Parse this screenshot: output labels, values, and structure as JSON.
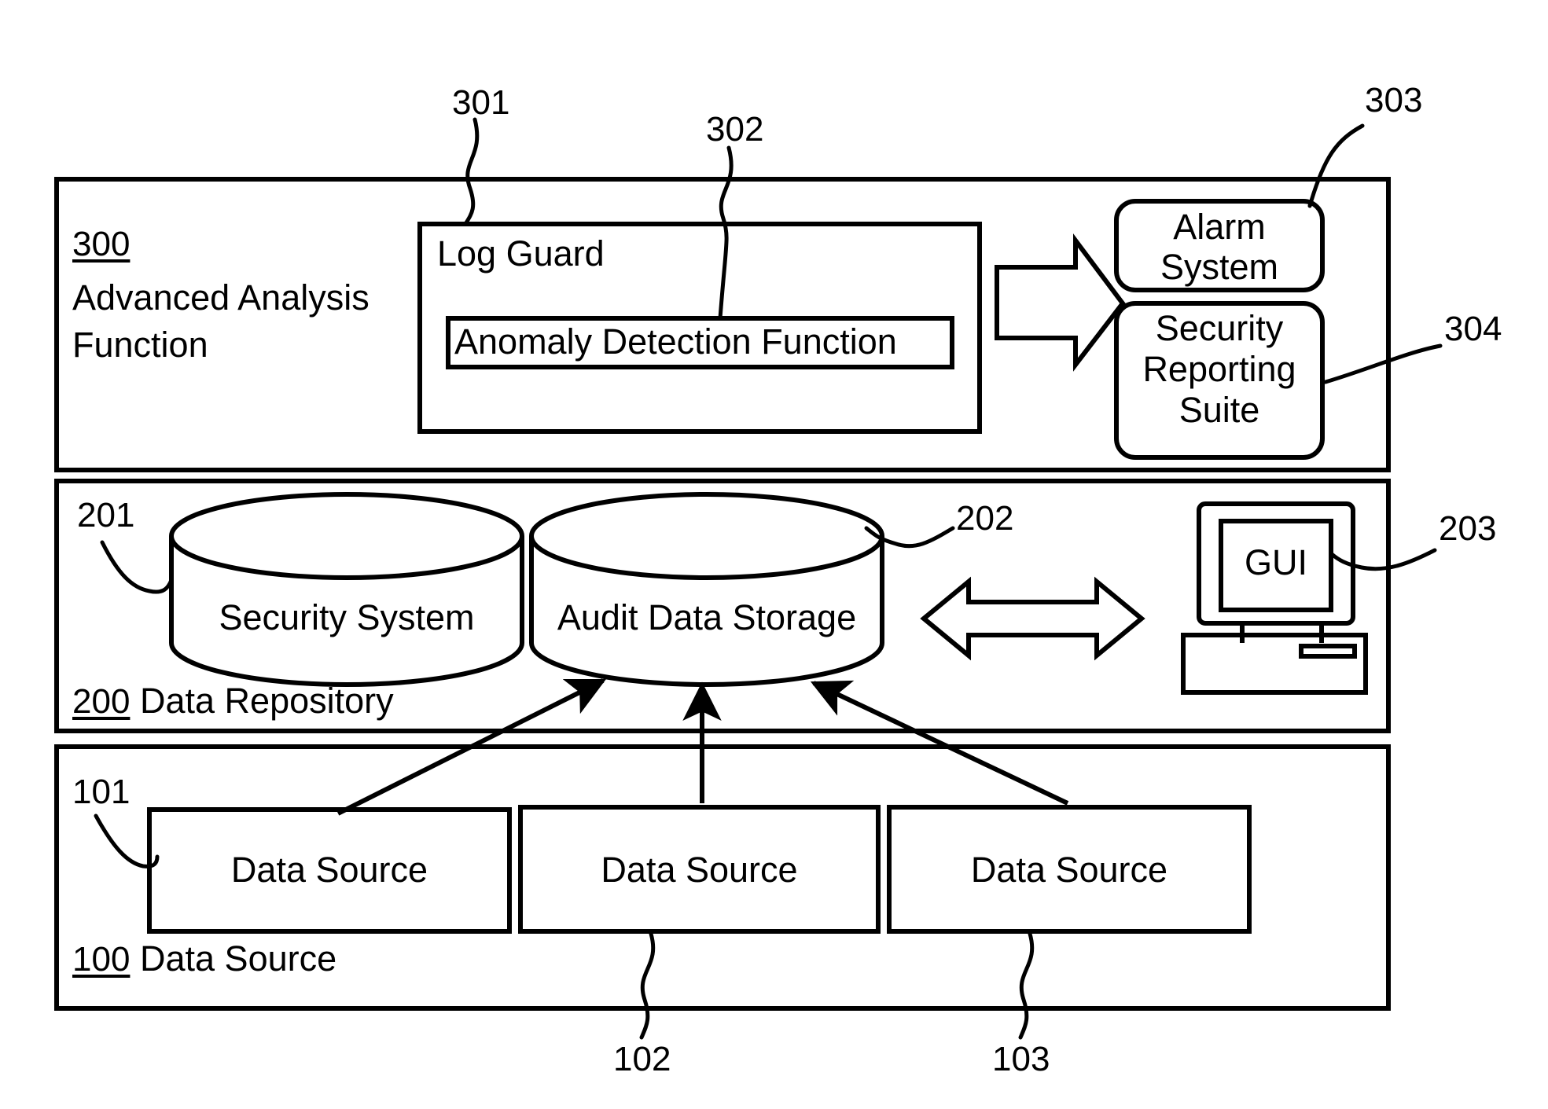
{
  "diagram": {
    "type": "block-diagram",
    "style": "patent-line-art",
    "line_color": "#000000",
    "background": "#ffffff"
  },
  "sections": [
    {
      "ref": "300",
      "title": "Advanced Analysis Function",
      "children": [
        {
          "ref": "301",
          "label": "Log Guard"
        },
        {
          "ref": "302",
          "label": "Anomaly Detection Function"
        },
        {
          "ref": "303",
          "label": "Alarm System"
        },
        {
          "ref": "304",
          "label": "Security Reporting Suite"
        }
      ]
    },
    {
      "ref": "200",
      "title": "Data Repository",
      "children": [
        {
          "ref": "201",
          "label": "Security System"
        },
        {
          "ref": "202",
          "label": "Audit Data Storage"
        },
        {
          "ref": "203",
          "label": "GUI"
        }
      ]
    },
    {
      "ref": "100",
      "title": "Data Source",
      "children": [
        {
          "ref": "101",
          "label": "Data Source"
        },
        {
          "ref": "102",
          "label": "Data Source"
        },
        {
          "ref": "103",
          "label": "Data Source"
        }
      ]
    }
  ],
  "labels": {
    "ref_300": "300",
    "title_300_line1": "Advanced Analysis",
    "title_300_line2": "Function",
    "ref_301": "301",
    "log_guard": "Log Guard",
    "ref_302": "302",
    "anomaly_detection": "Anomaly Detection Function",
    "ref_303": "303",
    "alarm_line1": "Alarm",
    "alarm_line2": "System",
    "ref_304": "304",
    "security_line1": "Security",
    "security_line2": "Reporting",
    "security_line3": "Suite",
    "ref_201": "201",
    "security_system": "Security System",
    "ref_202": "202",
    "audit_data_storage": "Audit Data Storage",
    "ref_203": "203",
    "gui": "GUI",
    "ref_200": "200",
    "data_repository": "Data Repository",
    "ref_101": "101",
    "data_source_1": "Data Source",
    "data_source_2": "Data Source",
    "data_source_3": "Data Source",
    "ref_100": "100",
    "data_source_title": "Data Source",
    "ref_102": "102",
    "ref_103": "103"
  }
}
